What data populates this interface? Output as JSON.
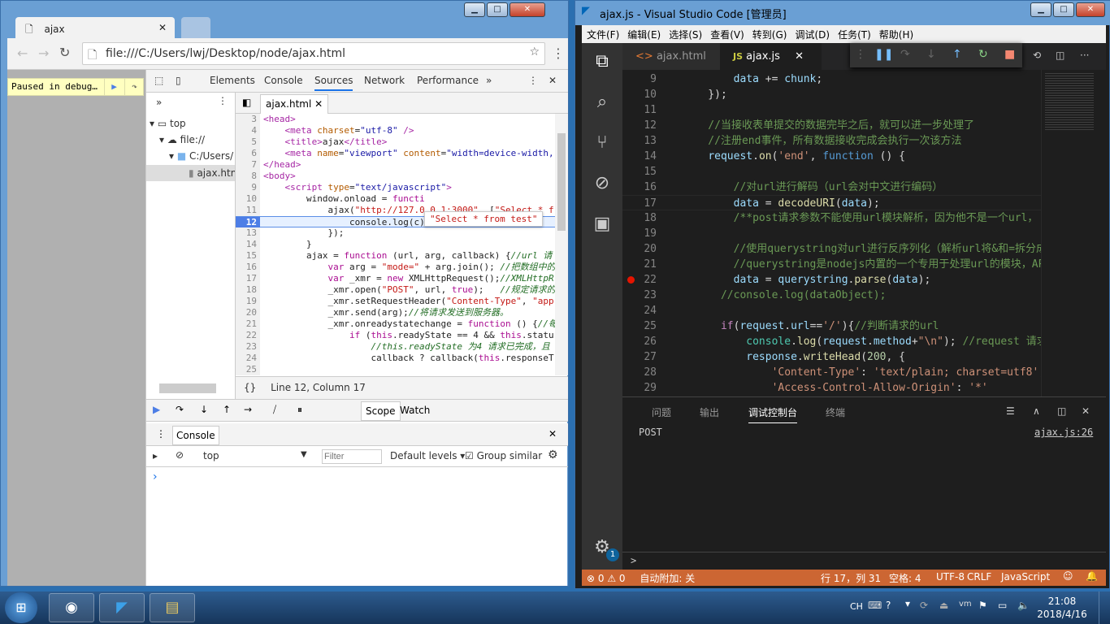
{
  "chrome": {
    "tab_title": "ajax",
    "url": "file:///C:/Users/lwj/Desktop/node/ajax.html",
    "paused_text": "Paused in debug…",
    "devtools_tabs": [
      "Elements",
      "Console",
      "Sources",
      "Network",
      "Performance"
    ],
    "active_tab": "Sources",
    "more_tabs": "»",
    "navigator": {
      "more": "»",
      "items": [
        "top",
        "file://",
        "C:/Users/",
        "ajax.htm"
      ]
    },
    "editor_tab": "ajax.html",
    "tooltip": "\"Select * from test\"",
    "status": "Line 12, Column 17",
    "status_braces": "{}",
    "sidebar_tabs": [
      "Scope",
      "Watch"
    ],
    "drawer": {
      "tab": "Console",
      "context": "top",
      "filter_placeholder": "Filter",
      "levels": "Default levels",
      "group_similar": "Group similar",
      "prompt": "›"
    },
    "code": [
      {
        "n": 3,
        "tok": [
          [
            "<head>",
            "tag"
          ]
        ]
      },
      {
        "n": 4,
        "tok": [
          [
            "    <meta ",
            "tag"
          ],
          [
            "charset",
            "attr"
          ],
          [
            "=",
            "txt"
          ],
          [
            "\"utf-8\"",
            "str"
          ],
          [
            " />",
            "tag"
          ]
        ]
      },
      {
        "n": 5,
        "tok": [
          [
            "    <title>",
            "tag"
          ],
          [
            "ajax",
            "txt"
          ],
          [
            "</title>",
            "tag"
          ]
        ]
      },
      {
        "n": 6,
        "tok": [
          [
            "    <meta ",
            "tag"
          ],
          [
            "name",
            "attr"
          ],
          [
            "=",
            "txt"
          ],
          [
            "\"viewport\"",
            "str"
          ],
          [
            " content",
            "attr"
          ],
          [
            "=",
            "txt"
          ],
          [
            "\"width=device-width,",
            "str"
          ]
        ]
      },
      {
        "n": 7,
        "tok": [
          [
            "</head>",
            "tag"
          ]
        ]
      },
      {
        "n": 8,
        "tok": [
          [
            "<body>",
            "tag"
          ]
        ]
      },
      {
        "n": 9,
        "tok": [
          [
            "    <script ",
            "tag"
          ],
          [
            "type",
            "attr"
          ],
          [
            "=",
            "txt"
          ],
          [
            "\"text/javascript\"",
            "str"
          ],
          [
            ">",
            "tag"
          ]
        ]
      },
      {
        "n": 10,
        "tok": [
          [
            "        window.onload = ",
            "txt"
          ],
          [
            "functi",
            "kw"
          ]
        ]
      },
      {
        "n": 11,
        "tok": [
          [
            "            ajax(",
            "txt"
          ],
          [
            "\"http://127.0.0.1:3000\"",
            "s2"
          ],
          [
            ", [",
            "txt"
          ],
          [
            "\"Select * f",
            "s2"
          ]
        ]
      },
      {
        "n": 12,
        "tok": [
          [
            "                console.",
            "txt"
          ],
          [
            "log(c);",
            "txt"
          ]
        ],
        "exec": true
      },
      {
        "n": 13,
        "tok": [
          [
            "            });",
            "txt"
          ]
        ]
      },
      {
        "n": 14,
        "tok": [
          [
            "        }",
            "txt"
          ]
        ]
      },
      {
        "n": 15,
        "tok": [
          [
            "        ajax = ",
            "txt"
          ],
          [
            "function",
            "kw"
          ],
          [
            " (url, arg, callback) {",
            "txt"
          ],
          [
            "//url 请",
            "cm"
          ]
        ]
      },
      {
        "n": 16,
        "tok": [
          [
            "            ",
            "txt"
          ],
          [
            "var",
            "kw"
          ],
          [
            " arg = ",
            "txt"
          ],
          [
            "\"mode=\"",
            "s2"
          ],
          [
            " + arg.join(); ",
            "txt"
          ],
          [
            "//把数组中的",
            "cm"
          ]
        ]
      },
      {
        "n": 17,
        "tok": [
          [
            "            ",
            "txt"
          ],
          [
            "var",
            "kw"
          ],
          [
            " _xmr = ",
            "txt"
          ],
          [
            "new",
            "kw"
          ],
          [
            " XMLHttpRequest();",
            "txt"
          ],
          [
            "//XMLHttpR",
            "cm"
          ]
        ]
      },
      {
        "n": 18,
        "tok": [
          [
            "            _xmr.open(",
            "txt"
          ],
          [
            "\"POST\"",
            "s2"
          ],
          [
            ", url, ",
            "txt"
          ],
          [
            "true",
            "kw"
          ],
          [
            ");   ",
            "txt"
          ],
          [
            "//规定请求的",
            "cm"
          ]
        ]
      },
      {
        "n": 19,
        "tok": [
          [
            "            _xmr.setRequestHeader(",
            "txt"
          ],
          [
            "\"Content-Type\"",
            "s2"
          ],
          [
            ", ",
            "txt"
          ],
          [
            "\"app",
            "s2"
          ]
        ]
      },
      {
        "n": 20,
        "tok": [
          [
            "            _xmr.send(arg);",
            "txt"
          ],
          [
            "//将请求发送到服务器。",
            "cm"
          ]
        ]
      },
      {
        "n": 21,
        "tok": [
          [
            "            _xmr.onreadystatechange = ",
            "txt"
          ],
          [
            "function",
            "kw"
          ],
          [
            " () {",
            "txt"
          ],
          [
            "//每",
            "cm"
          ]
        ]
      },
      {
        "n": 22,
        "tok": [
          [
            "                ",
            "txt"
          ],
          [
            "if",
            "kw"
          ],
          [
            " (",
            "txt"
          ],
          [
            "this",
            "kw"
          ],
          [
            ".readyState == 4 && ",
            "txt"
          ],
          [
            "this",
            "kw"
          ],
          [
            ".statu",
            "txt"
          ]
        ]
      },
      {
        "n": 23,
        "tok": [
          [
            "                    ",
            "txt"
          ],
          [
            "//this.readyState 为4 请求已完成，且",
            "cm"
          ]
        ]
      },
      {
        "n": 24,
        "tok": [
          [
            "                    callback ? callback(",
            "txt"
          ],
          [
            "this",
            "kw"
          ],
          [
            ".responseT",
            "txt"
          ]
        ]
      },
      {
        "n": 25,
        "tok": [
          [
            "",
            "txt"
          ]
        ]
      }
    ]
  },
  "vscode": {
    "title": "ajax.js - Visual Studio Code [管理员]",
    "menu": [
      "文件(F)",
      "编辑(E)",
      "选择(S)",
      "查看(V)",
      "转到(G)",
      "调试(D)",
      "任务(T)",
      "帮助(H)"
    ],
    "tabs": [
      {
        "label": "ajax.html",
        "icon": "<>"
      },
      {
        "label": "ajax.js",
        "icon": "JS"
      }
    ],
    "badge": "1",
    "code": [
      {
        "n": 9,
        "tok": [
          [
            "        ",
            "p"
          ],
          [
            "data",
            "var"
          ],
          [
            " += ",
            "p"
          ],
          [
            "chunk",
            "var"
          ],
          [
            ";",
            "p"
          ]
        ]
      },
      {
        "n": 10,
        "tok": [
          [
            "    });",
            "p"
          ]
        ]
      },
      {
        "n": 11,
        "tok": [
          [
            "",
            "p"
          ]
        ]
      },
      {
        "n": 12,
        "tok": [
          [
            "    //当接收表单提交的数据完毕之后，就可以进一步处理了",
            "cm"
          ]
        ]
      },
      {
        "n": 13,
        "tok": [
          [
            "    //注册end事件，所有数据接收完成会执行一次该方法",
            "cm"
          ]
        ]
      },
      {
        "n": 14,
        "tok": [
          [
            "    ",
            "p"
          ],
          [
            "request",
            "var"
          ],
          [
            ".",
            "p"
          ],
          [
            "on",
            "fn"
          ],
          [
            "(",
            "p"
          ],
          [
            "'end'",
            "str"
          ],
          [
            ", ",
            "p"
          ],
          [
            "function",
            "kw"
          ],
          [
            " () {",
            "p"
          ]
        ]
      },
      {
        "n": 15,
        "tok": [
          [
            "",
            "p"
          ]
        ]
      },
      {
        "n": 16,
        "tok": [
          [
            "        //对url进行解码（url会对中文进行编码）",
            "cm"
          ]
        ]
      },
      {
        "n": 17,
        "tok": [
          [
            "        ",
            "p"
          ],
          [
            "data",
            "var"
          ],
          [
            " = ",
            "p"
          ],
          [
            "decodeURI",
            "fn"
          ],
          [
            "(",
            "p"
          ],
          [
            "data",
            "var"
          ],
          [
            ");",
            "p"
          ]
        ]
      },
      {
        "n": 18,
        "tok": [
          [
            "        /**post请求参数不能使用url模块解析，因为他不是一个url，",
            "cm"
          ]
        ]
      },
      {
        "n": 19,
        "tok": [
          [
            "",
            "p"
          ]
        ]
      },
      {
        "n": 20,
        "tok": [
          [
            "        //使用querystring对url进行反序列化（解析url将&和=拆分成",
            "cm"
          ]
        ]
      },
      {
        "n": 21,
        "tok": [
          [
            "        //querystring是nodejs内置的一个专用于处理url的模块，API",
            "cm"
          ]
        ]
      },
      {
        "n": 22,
        "tok": [
          [
            "        ",
            "p"
          ],
          [
            "data",
            "var"
          ],
          [
            " = ",
            "p"
          ],
          [
            "querystring",
            "var"
          ],
          [
            ".",
            "p"
          ],
          [
            "parse",
            "fn"
          ],
          [
            "(",
            "p"
          ],
          [
            "data",
            "var"
          ],
          [
            ");",
            "p"
          ]
        ],
        "bp": true
      },
      {
        "n": 23,
        "tok": [
          [
            "      //console.log(dataObject);",
            "cm"
          ]
        ]
      },
      {
        "n": 24,
        "tok": [
          [
            "",
            "p"
          ]
        ]
      },
      {
        "n": 25,
        "tok": [
          [
            "      ",
            "p"
          ],
          [
            "if",
            "ctl"
          ],
          [
            "(",
            "p"
          ],
          [
            "request",
            "var"
          ],
          [
            ".",
            "p"
          ],
          [
            "url",
            "var"
          ],
          [
            "==",
            "p"
          ],
          [
            "'/'",
            "str"
          ],
          [
            "){",
            "p"
          ],
          [
            "//判断请求的url",
            "cm"
          ]
        ]
      },
      {
        "n": 26,
        "tok": [
          [
            "          ",
            "p"
          ],
          [
            "console",
            "cls"
          ],
          [
            ".",
            "p"
          ],
          [
            "log",
            "fn"
          ],
          [
            "(",
            "p"
          ],
          [
            "request",
            "var"
          ],
          [
            ".",
            "p"
          ],
          [
            "method",
            "var"
          ],
          [
            "+",
            "p"
          ],
          [
            "\"\\n\"",
            "str"
          ],
          [
            "); ",
            "p"
          ],
          [
            "//request 请求对",
            "cm"
          ]
        ]
      },
      {
        "n": 27,
        "tok": [
          [
            "          ",
            "p"
          ],
          [
            "response",
            "var"
          ],
          [
            ".",
            "p"
          ],
          [
            "writeHead",
            "fn"
          ],
          [
            "(",
            "p"
          ],
          [
            "200",
            "num"
          ],
          [
            ", {",
            "p"
          ]
        ]
      },
      {
        "n": 28,
        "tok": [
          [
            "              ",
            "p"
          ],
          [
            "'Content-Type'",
            "str"
          ],
          [
            ": ",
            "p"
          ],
          [
            "'text/plain; charset=utf8'",
            "str"
          ],
          [
            ",",
            "p"
          ]
        ]
      },
      {
        "n": 29,
        "tok": [
          [
            "              ",
            "p"
          ],
          [
            "'Access-Control-Allow-Origin'",
            "str"
          ],
          [
            ": ",
            "p"
          ],
          [
            "'*'",
            "str"
          ]
        ]
      }
    ],
    "panel_tabs": [
      "问题",
      "输出",
      "调试控制台",
      "终端"
    ],
    "active_panel": "调试控制台",
    "console_output": "POST",
    "console_source": "ajax.js:26",
    "console_prompt": ">",
    "status": {
      "errors": "0",
      "warnings": "0",
      "auto_attach": "自动附加: 关",
      "position": "行 17，列 31",
      "spaces": "空格: 4",
      "encoding": "UTF-8",
      "eol": "CRLF",
      "language": "JavaScript"
    },
    "colors": {
      "statusbar": "#cc6633",
      "editor_bg": "#1e1e1e"
    }
  },
  "taskbar": {
    "lang": "CH",
    "time": "21:08",
    "date": "2018/4/16"
  }
}
